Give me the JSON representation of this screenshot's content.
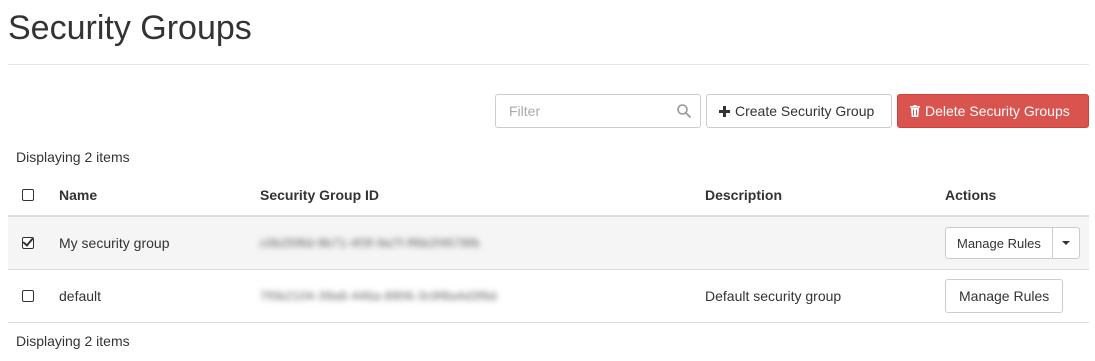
{
  "page": {
    "title": "Security Groups"
  },
  "toolbar": {
    "filter_placeholder": "Filter",
    "filter_icon": "search-icon",
    "create_label": "Create Security Group",
    "create_icon": "plus-icon",
    "delete_label": "Delete Security Groups",
    "delete_icon": "trash-icon"
  },
  "table": {
    "count_top": "Displaying 2 items",
    "count_bottom": "Displaying 2 items",
    "columns": {
      "name": "Name",
      "id": "Security Group ID",
      "description": "Description",
      "actions": "Actions"
    },
    "rows": [
      {
        "checked": true,
        "name": "My security group",
        "id": "c0b25f8d-9b71-4f3f-9a7f-ff6b2f4578fb",
        "description": "",
        "action_label": "Manage Rules",
        "has_dropdown": true
      },
      {
        "checked": false,
        "name": "default",
        "id": "7f0b2104-39a6-446a-8906-3c9f8a4d3f6d",
        "description": "Default security group",
        "action_label": "Manage Rules",
        "has_dropdown": false
      }
    ]
  },
  "colors": {
    "danger": "#d9534f",
    "border": "#cccccc",
    "text": "#333333",
    "row_selected": "#f5f5f5"
  }
}
